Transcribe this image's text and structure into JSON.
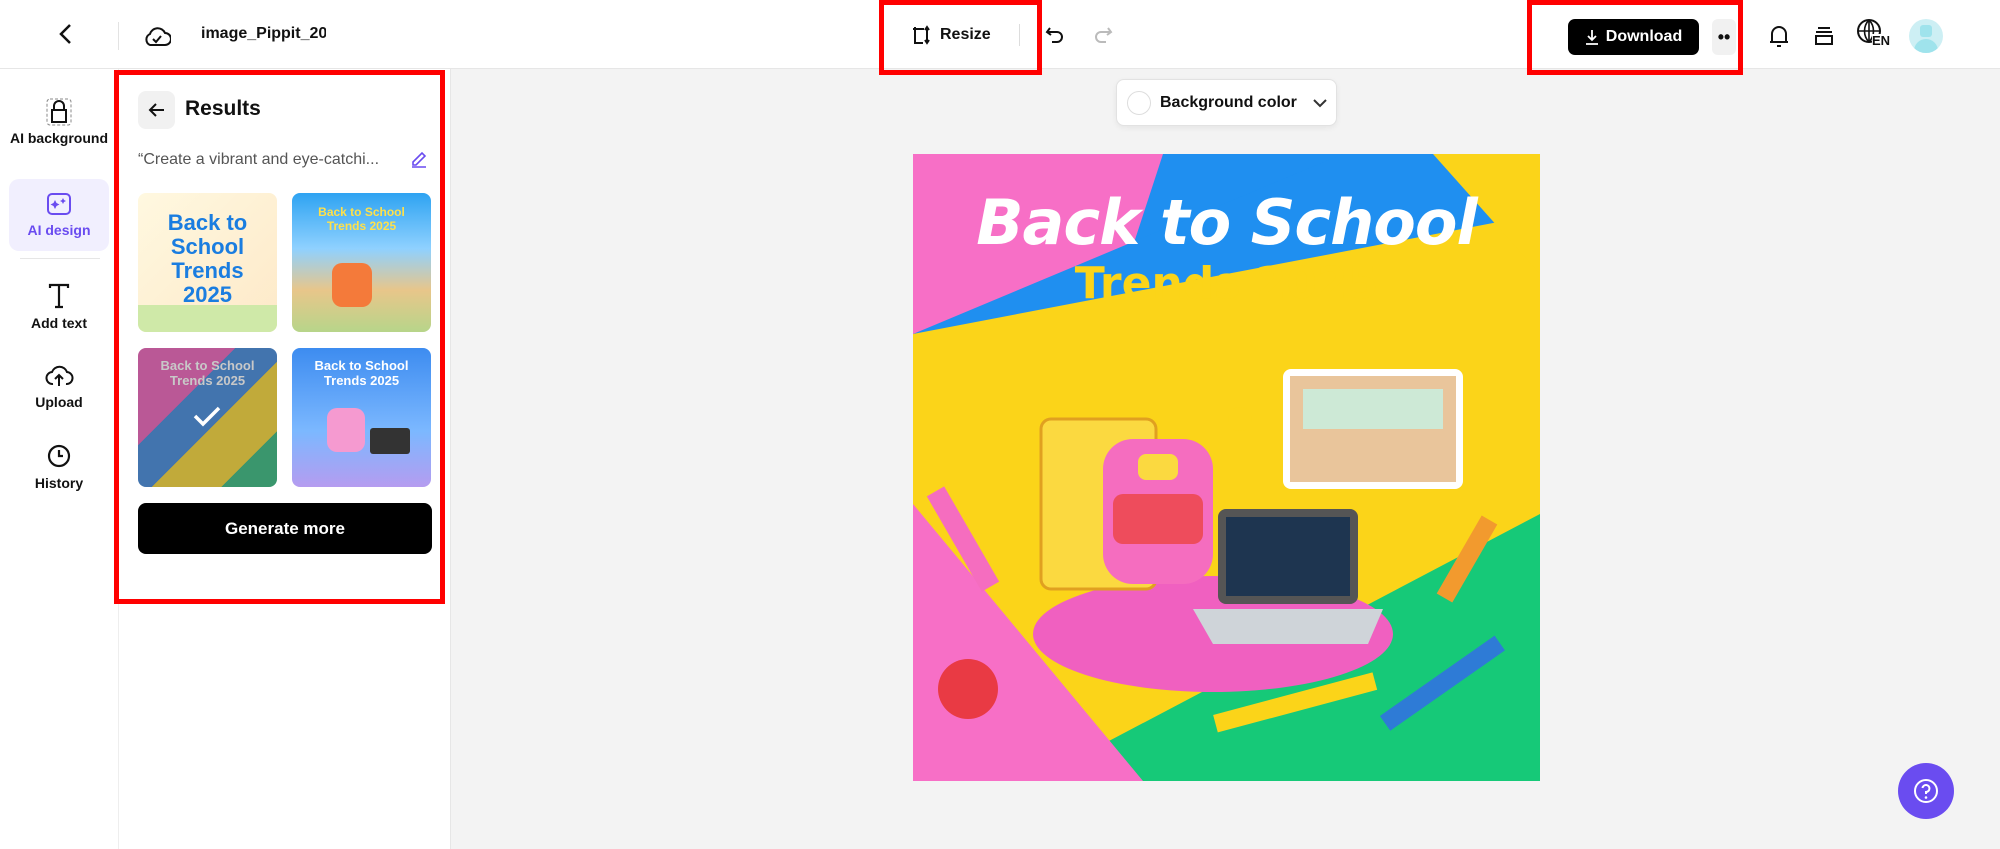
{
  "header": {
    "file_name": "image_Pippit_20",
    "resize_label": "Resize",
    "download_label": "Download",
    "language": "EN"
  },
  "rail": {
    "items": [
      {
        "label": "AI background"
      },
      {
        "label": "AI design"
      },
      {
        "label": "Add text"
      },
      {
        "label": "Upload"
      },
      {
        "label": "History"
      }
    ]
  },
  "panel": {
    "title": "Results",
    "prompt": "“Create a vibrant and eye-catchi...",
    "generate_more_label": "Generate more",
    "thumbnails": [
      {
        "title": "Back to School Trends 2025"
      },
      {
        "title": "Back to School Trends 2025"
      },
      {
        "title": "Back to School Trends 2025",
        "selected": true
      },
      {
        "title": "Back to School Trends 2025"
      }
    ]
  },
  "canvas": {
    "background_color_label": "Background color",
    "design_title_line1a": "Back",
    "design_title_line1b": "to School",
    "design_title_line2": "Trends 2025"
  },
  "colors": {
    "accent": "#6a4cf0",
    "highlight": "#ff0000",
    "help": "#6a4cf0"
  }
}
